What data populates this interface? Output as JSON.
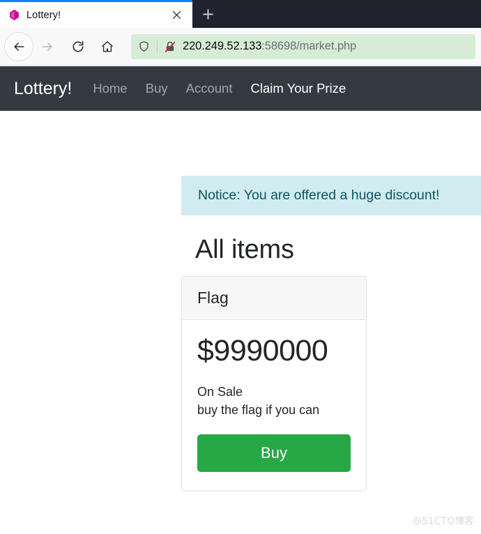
{
  "browser": {
    "tab": {
      "title": "Lottery!",
      "favicon": "gem-icon",
      "close_label": "×"
    },
    "new_tab_label": "+",
    "toolbar": {
      "back": "back-arrow-icon",
      "forward": "forward-arrow-icon",
      "reload": "reload-icon",
      "home": "home-icon"
    },
    "urlbar": {
      "shield_icon": "shield-icon",
      "lock_icon": "lock-crossed-out-icon",
      "host": "220.249.52.133",
      "port_path": ":58698/market.php"
    }
  },
  "site": {
    "brand": "Lottery!",
    "nav": [
      {
        "label": "Home",
        "active": false
      },
      {
        "label": "Buy",
        "active": false
      },
      {
        "label": "Account",
        "active": false
      },
      {
        "label": "Claim Your Prize",
        "active": true
      }
    ],
    "alert": "Notice: You are offered a huge discount!",
    "page_title": "All items",
    "item": {
      "name": "Flag",
      "price": "$9990000",
      "status": "On Sale",
      "description": "buy the flag if you can",
      "buy_label": "Buy"
    }
  },
  "watermark": "@51CTO博客",
  "colors": {
    "navbar": "#343a40",
    "alert_bg": "#d1ecf1",
    "alert_text": "#0c5460",
    "buy_button": "#28a745",
    "urlbar_bg": "#d7ecd7",
    "tab_accent": "#0a84ff"
  }
}
